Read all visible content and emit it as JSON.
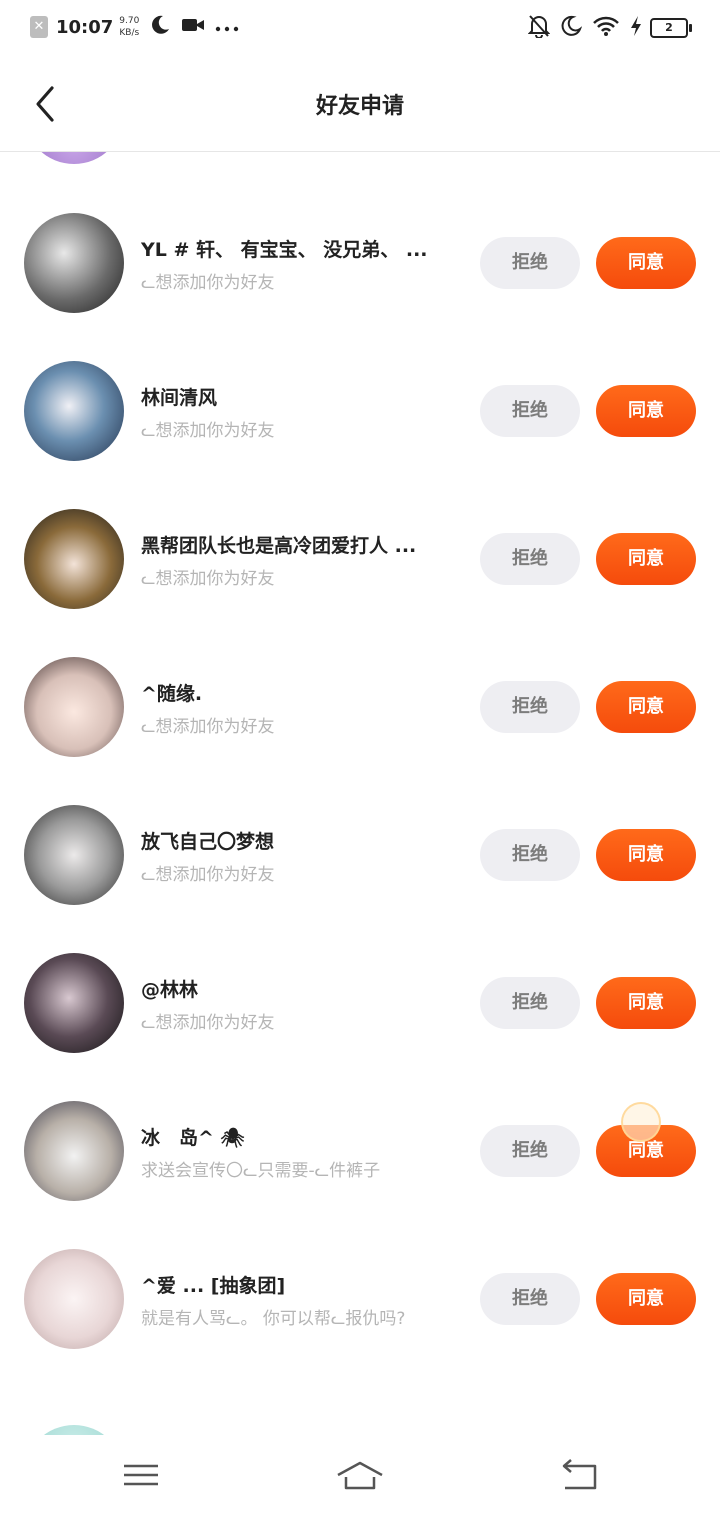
{
  "status_bar": {
    "time": "10:07",
    "speed_value": "9.70",
    "speed_unit": "KB/s",
    "battery": "2",
    "icons_left": [
      "sim-error-icon",
      "moon-icon",
      "video-icon",
      "more-dots-icon"
    ],
    "icons_right": [
      "bell-off-icon",
      "moon-icon",
      "wifi-icon",
      "charging-bolt-icon",
      "battery-icon"
    ]
  },
  "header": {
    "title": "好友申请",
    "back_icon": "chevron-left-icon"
  },
  "buttons": {
    "reject": "拒绝",
    "accept": "同意"
  },
  "colors": {
    "accent": "#f55a10",
    "reject_bg": "#eeeef2",
    "reject_text": "#7c7c7c",
    "muted_text": "#b5b5b5"
  },
  "requests": [
    {
      "name": "YL # 轩、 有宝宝、 没兄弟、 ...",
      "message": "ᓚ想添加你为好友"
    },
    {
      "name": "林间清风",
      "message": "ᓚ想添加你为好友"
    },
    {
      "name": "黑帮团队长也是高冷团爱打人 ...",
      "message": "ᓚ想添加你为好友"
    },
    {
      "name": "^随缘.",
      "message": "ᓚ想添加你为好友"
    },
    {
      "name": "放飞自己〇梦想",
      "message": "ᓚ想添加你为好友"
    },
    {
      "name": "@林林",
      "message": "ᓚ想添加你为好友"
    },
    {
      "name": "冰　岛^ 🕷",
      "message": "求送会宣传〇ᓚ只需要-ᓚ件裤子"
    },
    {
      "name": "^爱 ... [抽象团]",
      "message": "就是有人骂ᓚ。 你可以帮ᓚ报仇吗?"
    }
  ],
  "nav_bar": {
    "icons": [
      "menu-icon",
      "home-icon",
      "back-icon"
    ]
  }
}
